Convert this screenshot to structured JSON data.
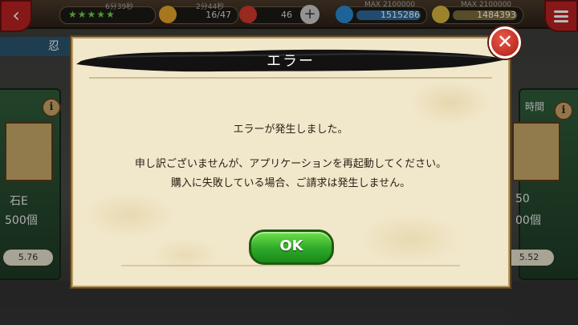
{
  "hud": {
    "timer1": "6分39秒",
    "timer2": "2分44秒",
    "stamina": "16/47",
    "gems": "46",
    "resource1_max": "MAX 2100000",
    "resource1_value": "1515286",
    "resource2_max": "MAX 2100000",
    "resource2_value": "1484393"
  },
  "background": {
    "tab_label": "忍",
    "left_card": {
      "name": "石E",
      "count": "500個",
      "price": "5.76"
    },
    "right_card": {
      "label": "時間",
      "name": "50",
      "count": "00個",
      "price": "5.52"
    }
  },
  "dialog": {
    "title": "エラー",
    "line1": "エラーが発生しました。",
    "line2": "申し訳ございませんが、アプリケーションを再起動してください。",
    "line3": "購入に失敗している場合、ご請求は発生しません。",
    "ok_label": "OK",
    "close_symbol": "✕"
  },
  "colors": {
    "ok_green": "#2ea82a",
    "close_red": "#c0231a",
    "paper": "#f1e7ca"
  }
}
